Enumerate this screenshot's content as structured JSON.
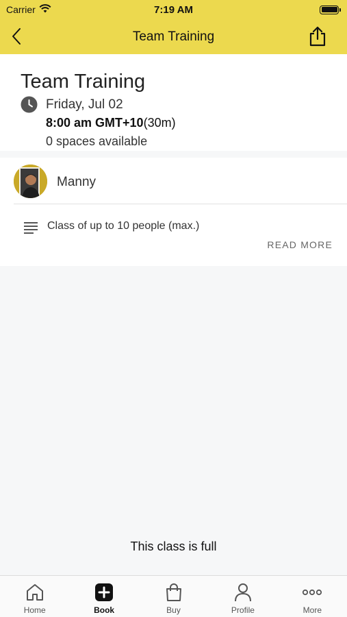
{
  "status_bar": {
    "carrier": "Carrier",
    "time": "7:19 AM"
  },
  "navbar": {
    "title": "Team Training"
  },
  "class_info": {
    "title": "Team Training",
    "date": "Friday, Jul 02",
    "time": "8:00 am GMT+10",
    "duration": "(30m)",
    "spaces": "0 spaces available"
  },
  "instructor": {
    "name": "Manny"
  },
  "description": {
    "text": "Class of up to 10 people (max.)",
    "read_more": "READ MORE"
  },
  "message": "This class is full",
  "tabs": [
    {
      "label": "Home",
      "icon": "home-icon"
    },
    {
      "label": "Book",
      "icon": "plus-square-icon",
      "active": true
    },
    {
      "label": "Buy",
      "icon": "bag-icon"
    },
    {
      "label": "Profile",
      "icon": "person-icon"
    },
    {
      "label": "More",
      "icon": "more-dots-icon"
    }
  ],
  "colors": {
    "header": "#ecd94e",
    "background": "#f6f7f8"
  }
}
